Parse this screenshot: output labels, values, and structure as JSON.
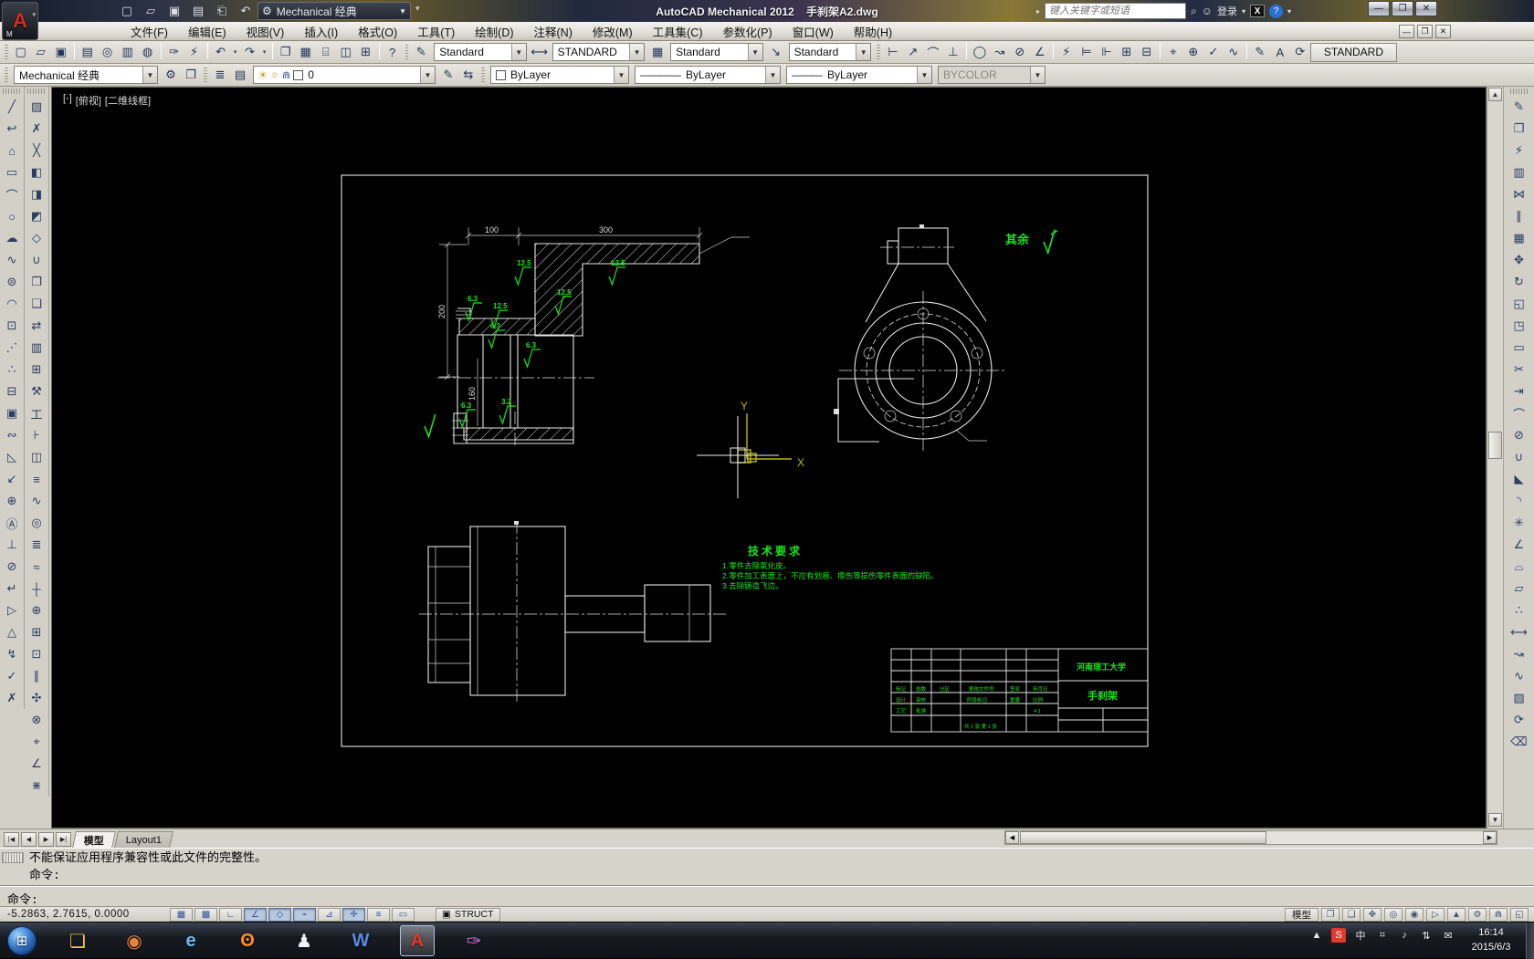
{
  "window": {
    "title": "AutoCAD Mechanical 2012    手刹架A2.dwg",
    "workspace": "Mechanical 经典",
    "search_placeholder": "键入关键字或短语",
    "login_label": "登录",
    "min": "—",
    "max": "❐",
    "close": "✕"
  },
  "menu": {
    "items": [
      {
        "n": "menu-file",
        "label": "文件(F)"
      },
      {
        "n": "menu-edit",
        "label": "编辑(E)"
      },
      {
        "n": "menu-view",
        "label": "视图(V)"
      },
      {
        "n": "menu-insert",
        "label": "插入(I)"
      },
      {
        "n": "menu-format",
        "label": "格式(O)"
      },
      {
        "n": "menu-tools",
        "label": "工具(T)"
      },
      {
        "n": "menu-draw",
        "label": "绘制(D)"
      },
      {
        "n": "menu-annotate",
        "label": "注释(N)"
      },
      {
        "n": "menu-modify",
        "label": "修改(M)"
      },
      {
        "n": "menu-toolsets",
        "label": "工具集(C)"
      },
      {
        "n": "menu-parametric",
        "label": "参数化(P)"
      },
      {
        "n": "menu-window",
        "label": "窗口(W)"
      },
      {
        "n": "menu-help",
        "label": "帮助(H)"
      }
    ]
  },
  "qat": {
    "icons": [
      {
        "n": "qat-new-icon",
        "g": "▢"
      },
      {
        "n": "qat-open-icon",
        "g": "▱"
      },
      {
        "n": "qat-save-icon",
        "g": "▣"
      },
      {
        "n": "qat-saveas-icon",
        "g": "▤"
      },
      {
        "n": "qat-plot-icon",
        "g": "⎗"
      },
      {
        "n": "qat-undo-icon",
        "g": "↶"
      },
      {
        "n": "qat-undo-drop",
        "g": "▾"
      },
      {
        "n": "qat-redo-icon",
        "g": "↷"
      },
      {
        "n": "qat-redo-drop",
        "g": "▾"
      },
      {
        "n": "qat-customize-icon",
        "g": "❐"
      }
    ],
    "workspace_gear": "⚙",
    "overflow": "▾"
  },
  "toolbarA": {
    "file_icons": [
      {
        "n": "new-button",
        "g": "▢"
      },
      {
        "n": "open-button",
        "g": "▱"
      },
      {
        "n": "save-button",
        "g": "▣"
      },
      {
        "n": "separator",
        "g": "|"
      },
      {
        "n": "plot-button",
        "g": "▤"
      },
      {
        "n": "plot-preview-button",
        "g": "◎"
      },
      {
        "n": "publish-button",
        "g": "▥"
      },
      {
        "n": "dwf-button",
        "g": "◍"
      },
      {
        "n": "separator",
        "g": "|"
      },
      {
        "n": "match-properties-button",
        "g": "✑"
      },
      {
        "n": "power-match-button",
        "g": "⚡"
      },
      {
        "n": "separator",
        "g": "|"
      },
      {
        "n": "undo-button",
        "g": "↶"
      },
      {
        "n": "undo-dropdown",
        "g": "▾",
        "s": 1
      },
      {
        "n": "redo-button",
        "g": "↷"
      },
      {
        "n": "redo-dropdown",
        "g": "▾",
        "s": 1
      },
      {
        "n": "separator",
        "g": "|"
      },
      {
        "n": "viewport-dialog-button",
        "g": "❐"
      },
      {
        "n": "sheetset-manager-button",
        "g": "▦"
      },
      {
        "n": "tool-palettes-button",
        "g": "⌸"
      },
      {
        "n": "markup-manager-button",
        "g": "◫"
      },
      {
        "n": "quick-calc-button",
        "g": "⊞"
      },
      {
        "n": "separator",
        "g": "|"
      },
      {
        "n": "help-button",
        "g": "?"
      }
    ],
    "text_style_icon": "✎",
    "text_style": "Standard",
    "dim_style_icon": "⟷",
    "dim_style": "STANDARD",
    "table_style_icon": "▦",
    "table_style": "Standard",
    "mleader_style_icon": "↘",
    "mleader_style": "Standard",
    "dim_icons": [
      {
        "n": "dim-linear-button",
        "g": "⊢"
      },
      {
        "n": "dim-aligned-button",
        "g": "↗"
      },
      {
        "n": "dim-arc-length-button",
        "g": "⌒"
      },
      {
        "n": "dim-ordinate-button",
        "g": "⊥"
      },
      {
        "n": "separator",
        "g": "|"
      },
      {
        "n": "dim-radius-button",
        "g": "◯"
      },
      {
        "n": "dim-jogged-button",
        "g": "↝"
      },
      {
        "n": "dim-diameter-button",
        "g": "⊘"
      },
      {
        "n": "dim-angular-button",
        "g": "∠"
      },
      {
        "n": "separator",
        "g": "|"
      },
      {
        "n": "quick-dimension-button",
        "g": "⚡"
      },
      {
        "n": "dim-baseline-button",
        "g": "⊨"
      },
      {
        "n": "dim-continue-button",
        "g": "⊩"
      },
      {
        "n": "dim-space-button",
        "g": "⊞"
      },
      {
        "n": "dim-break-button",
        "g": "⊟"
      },
      {
        "n": "separator",
        "g": "|"
      },
      {
        "n": "tolerance-button",
        "g": "⌖"
      },
      {
        "n": "center-mark-button",
        "g": "⊕"
      },
      {
        "n": "dim-inspect-button",
        "g": "✓"
      },
      {
        "n": "dim-jog-line-button",
        "g": "∿"
      },
      {
        "n": "separator",
        "g": "|"
      },
      {
        "n": "dim-edit-button",
        "g": "✎"
      },
      {
        "n": "dim-text-edit-button",
        "g": "A"
      },
      {
        "n": "dim-update-button",
        "g": "⟳"
      }
    ],
    "mech_standard": "STANDARD"
  },
  "toolbarB": {
    "workspace": "Mechanical 经典",
    "gear_icon": "⚙",
    "fit_icon": "❐",
    "layer_icons": [
      {
        "n": "layer-properties-button",
        "g": "≣"
      },
      {
        "n": "layer-states-button",
        "g": "▤"
      }
    ],
    "layer_combo": {
      "bulb": "☀",
      "sun": "☼",
      "lock": "⋒",
      "name": "0"
    },
    "layer_tail_icons": [
      {
        "n": "make-layer-current-button",
        "g": "✎"
      },
      {
        "n": "layer-previous-button",
        "g": "⇆"
      }
    ],
    "color": "ByLayer",
    "linetype": "ByLayer",
    "lineweight": "ByLayer",
    "plot_style": "BYCOLOR"
  },
  "palette": {
    "col1": [
      {
        "n": "line-tool",
        "g": "╱"
      },
      {
        "n": "polyline-tool",
        "g": "↩"
      },
      {
        "n": "polygon-tool",
        "g": "⌂"
      },
      {
        "n": "rectangle-tool",
        "g": "▭"
      },
      {
        "n": "arc-tool",
        "g": "⌒"
      },
      {
        "n": "circle-tool",
        "g": "○"
      },
      {
        "n": "revision-cloud-tool",
        "g": "☁"
      },
      {
        "n": "spline-tool",
        "g": "∿"
      },
      {
        "n": "ellipse-tool",
        "g": "⊜"
      },
      {
        "n": "ellipse-arc-tool",
        "g": "◠"
      },
      {
        "n": "insert-block-tool",
        "g": "⊡"
      },
      {
        "n": "construction-line-tool",
        "g": "⋰"
      },
      {
        "n": "point-tool",
        "g": "∴"
      },
      {
        "n": "section-line-tool",
        "g": "⊟"
      },
      {
        "n": "block-editor-tool",
        "g": "▣"
      },
      {
        "n": "break-line-tool",
        "g": "∾"
      },
      {
        "n": "chamfer-note-tool",
        "g": "◺"
      },
      {
        "n": "leader-tool",
        "g": "↙"
      },
      {
        "n": "balloon-tool",
        "g": "⊕"
      },
      {
        "n": "datum-tool",
        "g": "Ⓐ"
      },
      {
        "n": "power-dimension-tool",
        "g": "⊥"
      },
      {
        "n": "radius-note-tool",
        "g": "⊘"
      },
      {
        "n": "edit-dimension-tool",
        "g": "↵"
      },
      {
        "n": "taper-symbol-tool",
        "g": "▷"
      },
      {
        "n": "feature-control-tool",
        "g": "△"
      },
      {
        "n": "weld-symbol-tool",
        "g": "↯"
      },
      {
        "n": "surface-texture-add-tool",
        "g": "✓"
      },
      {
        "n": "surface-texture-del-tool",
        "g": "✗"
      }
    ],
    "col2": [
      {
        "n": "hatch-tool",
        "g": "▨"
      },
      {
        "n": "power-erase-tool",
        "g": "✗"
      },
      {
        "n": "construction-menu-tool",
        "g": "╳"
      },
      {
        "n": "rectangle-zone-tool",
        "g": "◧"
      },
      {
        "n": "detail-view-tool",
        "g": "◨"
      },
      {
        "n": "view-zone-tool",
        "g": "◩"
      },
      {
        "n": "scale-monitor-tool",
        "g": "◇"
      },
      {
        "n": "power-snap-tool",
        "g": "∪"
      },
      {
        "n": "copy-object-tool",
        "g": "❐"
      },
      {
        "n": "edit-copy-tool",
        "g": "❏"
      },
      {
        "n": "translate-annotation-tool",
        "g": "⇄"
      },
      {
        "n": "library-tool",
        "g": "▥"
      },
      {
        "n": "parts-list-tool",
        "g": "⊞"
      },
      {
        "n": "fastener-tool",
        "g": "⚒"
      },
      {
        "n": "steel-shapes-tool",
        "g": "工"
      },
      {
        "n": "screw-tool",
        "g": "⊦"
      },
      {
        "n": "washer-tool",
        "g": "◫"
      },
      {
        "n": "pipe-tool",
        "g": "≡"
      },
      {
        "n": "spring-tool",
        "g": "∿"
      },
      {
        "n": "bearing-tool",
        "g": "◎"
      },
      {
        "n": "shaft-generator-tool",
        "g": "≣"
      },
      {
        "n": "thread-tool",
        "g": "≈"
      },
      {
        "n": "centerline-tool",
        "g": "┼"
      },
      {
        "n": "centerline-circle-tool",
        "g": "⊕"
      },
      {
        "n": "centerline-grid-tool",
        "g": "⊞"
      },
      {
        "n": "centerline-square-tool",
        "g": "⊡"
      },
      {
        "n": "parallel-construction-tool",
        "g": "∥"
      },
      {
        "n": "multiple-holes-tool",
        "g": "✣"
      },
      {
        "n": "hole-chart-tool",
        "g": "⊗"
      },
      {
        "n": "centerline-cross-hole-tool",
        "g": "⌖"
      },
      {
        "n": "centerline-angle-tool",
        "g": "∠"
      },
      {
        "n": "centerline-ray-tool",
        "g": "⋇"
      }
    ]
  },
  "rightbar": {
    "icons": [
      {
        "n": "power-edit-tool",
        "g": "✎"
      },
      {
        "n": "power-copy-tool",
        "g": "❐"
      },
      {
        "n": "power-recall-tool",
        "g": "⚡"
      },
      {
        "n": "hide-situation-tool",
        "g": "▥"
      },
      {
        "n": "mirror-tool",
        "g": "⋈"
      },
      {
        "n": "offset-tool",
        "g": "∥"
      },
      {
        "n": "array-tool",
        "g": "▦"
      },
      {
        "n": "move-tool",
        "g": "✥"
      },
      {
        "n": "rotate-tool",
        "g": "↻"
      },
      {
        "n": "scale-tool",
        "g": "◱"
      },
      {
        "n": "stretch-tool",
        "g": "◳"
      },
      {
        "n": "align-tool",
        "g": "▭"
      },
      {
        "n": "trim-tool",
        "g": "✂"
      },
      {
        "n": "extend-tool",
        "g": "⇥"
      },
      {
        "n": "break-at-point-tool",
        "g": "⌒"
      },
      {
        "n": "break-tool",
        "g": "⊘"
      },
      {
        "n": "join-tool",
        "g": "∪"
      },
      {
        "n": "chamfer-tool",
        "g": "◣"
      },
      {
        "n": "fillet-tool",
        "g": "◝"
      },
      {
        "n": "explode-tool",
        "g": "✳"
      },
      {
        "n": "measure-tool",
        "g": "∠"
      },
      {
        "n": "profile-tool",
        "g": "⌓"
      },
      {
        "n": "region-tool",
        "g": "▱"
      },
      {
        "n": "divide-tool",
        "g": "∴"
      },
      {
        "n": "lengthen-tool",
        "g": "⟷"
      },
      {
        "n": "edit-polyline-tool",
        "g": "↝"
      },
      {
        "n": "edit-spline-tool",
        "g": "∿"
      },
      {
        "n": "edit-hatch-tool",
        "g": "▨"
      },
      {
        "n": "annotation-update-tool",
        "g": "⟳"
      },
      {
        "n": "erase-tool",
        "g": "⌫"
      }
    ]
  },
  "viewport": {
    "segments": [
      {
        "n": "viewport-controls",
        "label": "[-]"
      },
      {
        "n": "viewport-view-label",
        "label": "[俯视]"
      },
      {
        "n": "viewport-visual-style",
        "label": "[二维线框]"
      }
    ]
  },
  "drawing": {
    "ucs": {
      "x": "X",
      "y": "Y"
    },
    "qiyu": "其余",
    "tech": {
      "title": "技术要求",
      "lines": [
        "1.零件去除氧化皮。",
        "2.零件加工表面上，不应有划痕、擦伤等损伤零件表面的缺陷。",
        "3.去除铸造飞边。"
      ]
    },
    "dims": {
      "d100": "100",
      "d300": "300",
      "d200": "200",
      "d160": "160"
    },
    "sf": [
      "12.5",
      "12.5",
      "12.5",
      "6.3",
      "12.5",
      "6.3",
      "6.3",
      "6.3",
      "3.2"
    ],
    "title_block": {
      "school": "河南理工大学",
      "part": "手刹架",
      "row1": [
        "标记",
        "处数",
        "分区",
        "更改文件号",
        "签名",
        "年月日"
      ],
      "row2": [
        "设计",
        "审核",
        "工艺",
        "批准"
      ],
      "row3": [
        "阶段标记",
        "重量",
        "比例"
      ],
      "scale": "4:1",
      "sheet": "共 1 张 第 1 张"
    }
  },
  "tabs": {
    "nav": [
      {
        "n": "tab-first-button",
        "g": "|◀"
      },
      {
        "n": "tab-prev-button",
        "g": "◀"
      },
      {
        "n": "tab-next-button",
        "g": "▶"
      },
      {
        "n": "tab-last-button",
        "g": "▶|"
      }
    ],
    "model": "模型",
    "layout1": "Layout1"
  },
  "command": {
    "history1": "不能保证应用程序兼容性或此文件的完整性。",
    "history2": "命令:",
    "prompt": "命令:"
  },
  "status": {
    "coords": "-5.2863,  2.7615,  0.0000",
    "toggles": [
      {
        "n": "snap-toggle",
        "g": "▦"
      },
      {
        "n": "grid-toggle",
        "g": "▩"
      },
      {
        "n": "ortho-toggle",
        "g": "∟"
      },
      {
        "n": "polar-toggle",
        "g": "∠",
        "p": 1
      },
      {
        "n": "osnap-toggle",
        "g": "◇",
        "p": 1
      },
      {
        "n": "otrack-toggle",
        "g": "⌁",
        "p": 1
      },
      {
        "n": "ducs-toggle",
        "g": "⊿"
      },
      {
        "n": "dyn-toggle",
        "g": "✛",
        "p": 1
      },
      {
        "n": "lwt-toggle",
        "g": "≡"
      },
      {
        "n": "qp-toggle",
        "g": "▭"
      }
    ],
    "struct_icon": "▣",
    "struct": "STRUCT",
    "model_label": "模型",
    "right_icons": [
      {
        "n": "quick-view-layouts-button",
        "g": "❐"
      },
      {
        "n": "quick-view-drawings-button",
        "g": "❑"
      },
      {
        "n": "pan-button",
        "g": "✥"
      },
      {
        "n": "zoom-button",
        "g": "◎"
      },
      {
        "n": "steering-wheel-button",
        "g": "◉"
      },
      {
        "n": "show-motion-button",
        "g": "▷"
      },
      {
        "n": "annotation-scale-button",
        "g": "▲"
      },
      {
        "n": "workspace-switch-button",
        "g": "⚙"
      },
      {
        "n": "toolbar-lock-button",
        "g": "⋒"
      },
      {
        "n": "clean-screen-button",
        "g": "◱"
      }
    ]
  },
  "taskbar": {
    "start_glyph": "⊞",
    "apps": [
      {
        "n": "explorer-icon",
        "g": "❏",
        "c": "#f3c84b"
      },
      {
        "n": "media-player-icon",
        "g": "◉",
        "c": "#e8833a"
      },
      {
        "n": "browser-icon",
        "g": "e",
        "c": "#6db9f0"
      },
      {
        "n": "firefox-icon",
        "g": "ʘ",
        "c": "#ff8a2a"
      },
      {
        "n": "qq-icon",
        "g": "♟",
        "c": "#eef2f8"
      },
      {
        "n": "word-icon",
        "g": "W",
        "c": "#5a8ae0"
      },
      {
        "n": "autocad-icon",
        "g": "A",
        "c": "#e03a2a",
        "a": 1
      },
      {
        "n": "paint-icon",
        "g": "✑",
        "c": "#c86ad0"
      }
    ],
    "tray": [
      {
        "n": "tray-expand-icon",
        "g": "▲"
      },
      {
        "n": "sogou-icon",
        "g": "S",
        "c": "#fff",
        "bg": "#e03a2f"
      },
      {
        "n": "ime-indicator",
        "g": "中"
      },
      {
        "n": "keyboard-icon",
        "g": "⌗"
      },
      {
        "n": "volume-icon",
        "g": "♪"
      },
      {
        "n": "network-icon",
        "g": "⇅"
      },
      {
        "n": "message-icon",
        "g": "✉"
      }
    ],
    "time": "16:14",
    "date": "2015/6/3"
  }
}
